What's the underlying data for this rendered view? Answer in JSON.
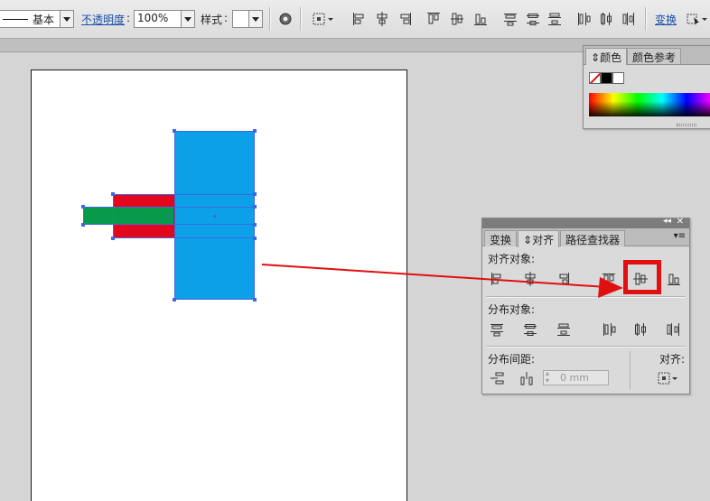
{
  "control_bar": {
    "stroke_profile_label": "基本",
    "opacity_label": "不透明度",
    "opacity_value": "100%",
    "style_label": "样式",
    "transform_label": "变换",
    "icons": [
      "recolor-icon",
      "align-to-selection-icon",
      "horizontal-align-left-icon",
      "horizontal-align-center-icon",
      "horizontal-align-right-icon",
      "vertical-align-top-icon",
      "vertical-align-center-icon",
      "vertical-align-bottom-icon",
      "distribute-top-icon",
      "distribute-vcenter-icon",
      "distribute-bottom-icon",
      "distribute-left-icon",
      "distribute-hcenter-icon",
      "distribute-right-icon",
      "isolate-icon"
    ]
  },
  "color_panel": {
    "tabs": [
      "颜色",
      "颜色参考"
    ],
    "active_tab": "颜色"
  },
  "align_panel": {
    "tabs": [
      "变换",
      "对齐",
      "路径查找器"
    ],
    "active_tab": "对齐",
    "align_objects_label": "对齐对象:",
    "distribute_objects_label": "分布对象:",
    "distribute_spacing_label": "分布间距:",
    "align_to_label": "对齐:",
    "spacing_value": "0 mm",
    "highlighted_button": "vertical-align-center"
  },
  "colors": {
    "selection_blue": "#3f68e0",
    "cyan_rect": "#0ba0e8",
    "red_rect": "#e3071d",
    "green_rect": "#079a4a",
    "annotation_red": "#e01010"
  }
}
